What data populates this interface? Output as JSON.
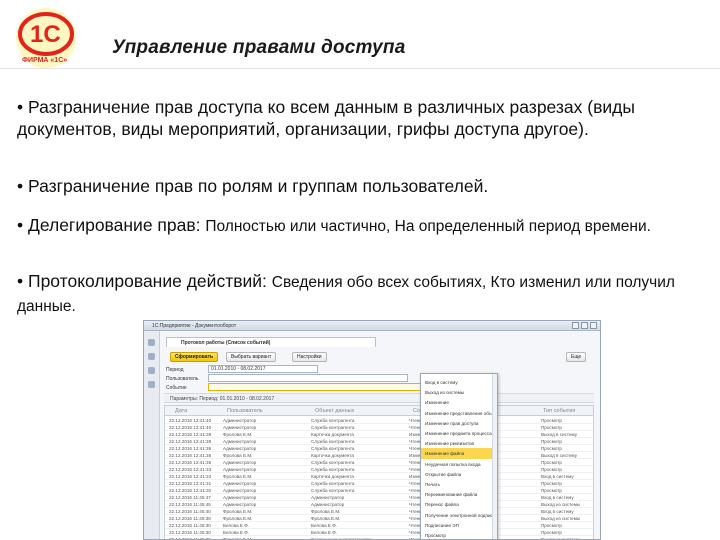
{
  "header": {
    "logo_text": "1С",
    "logo_caption": "ФИРМА «1С»",
    "title": "Управление правами доступа"
  },
  "bullets": [
    {
      "main": "• Разграничение прав доступа ко всем данным в различных разрезах (виды документов, виды мероприятий, организации, грифы доступа другое).",
      "sub": ""
    },
    {
      "main": "• Разграничение прав по ролям и группам пользователей.",
      "sub": ""
    },
    {
      "main": "• Делегирование прав: ",
      "sub": "Полностью или частично, На определенный период времени."
    },
    {
      "main": "• Протоколирование действий: ",
      "sub": "Сведения обо всех событиях, Кто изменил или получил данные."
    }
  ],
  "app": {
    "window_title": "1С:Предприятие - Документооборот",
    "tab_title": "Протокол работы (Список событий)",
    "toolbar": {
      "form_button": "Сформировать",
      "print_button": "Выбрать вариант",
      "settings_button": "Настройки",
      "more_button": "Еще"
    },
    "filters": [
      {
        "label": "Период",
        "value": "01.01.2010 - 08.02.2017"
      },
      {
        "label": "Пользователь",
        "value": ""
      },
      {
        "label": "Событие",
        "value": ""
      }
    ],
    "params_text": "Параметры:   Период: 01.01.2010 - 08.02.2017",
    "grid_headers": {
      "date": "Дата",
      "user": "Пользователь",
      "object": "Объект данных",
      "event": "Событие",
      "event_type": "Тип события"
    },
    "rows": [
      {
        "date": "22.12.2016 12:41:40",
        "user": "Администратор",
        "object": "Служба контрагента",
        "event": "Чтение",
        "type": "Просмотр"
      },
      {
        "date": "22.12.2016 12:41:40",
        "user": "Администратор",
        "object": "Служба контрагента",
        "event": "Чтение",
        "type": "Просмотр"
      },
      {
        "date": "22.12.2016 12:41:38",
        "user": "Фролова Е.М.",
        "object": "Карточка документа",
        "event": "Изменение",
        "type": "Выход в систему"
      },
      {
        "date": "22.12.2016 12:41:38",
        "user": "Администратор",
        "object": "Служба контрагента",
        "event": "Чтение",
        "type": "Просмотр"
      },
      {
        "date": "22.12.2016 12:41:36",
        "user": "Администратор",
        "object": "Служба контрагента",
        "event": "Чтение",
        "type": "Просмотр"
      },
      {
        "date": "22.12.2016 12:41:35",
        "user": "Фролова Е.М.",
        "object": "Карточка документа",
        "event": "Изменение",
        "type": "Выход в систему"
      },
      {
        "date": "22.12.2016 12:41:35",
        "user": "Администратор",
        "object": "Служба контрагента",
        "event": "Чтение",
        "type": "Просмотр"
      },
      {
        "date": "22.12.2016 12:41:33",
        "user": "Администратор",
        "object": "Служба контрагента",
        "event": "Чтение",
        "type": "Просмотр"
      },
      {
        "date": "22.12.2016 12:41:33",
        "user": "Фролова Е.М.",
        "object": "Карточка документа",
        "event": "Изменение",
        "type": "Вход в систему"
      },
      {
        "date": "22.12.2016 12:41:31",
        "user": "Администратор",
        "object": "Служба контрагента",
        "event": "Чтение",
        "type": "Просмотр"
      },
      {
        "date": "22.12.2016 12:41:30",
        "user": "Администратор",
        "object": "Служба контрагента",
        "event": "Чтение",
        "type": "Просмотр"
      },
      {
        "date": "22.12.2016 11:45:47",
        "user": "Администратор",
        "object": "Администратор",
        "event": "Чтение",
        "type": "Вход в систему"
      },
      {
        "date": "22.12.2016 11:45:45",
        "user": "Администратор",
        "object": "Администратор",
        "event": "Чтение",
        "type": "Выход из системы"
      },
      {
        "date": "22.12.2016 11:45:40",
        "user": "Фролова Е.М.",
        "object": "Фролова Е.М.",
        "event": "Чтение",
        "type": "Вход в систему"
      },
      {
        "date": "22.12.2016 11:45:38",
        "user": "Фролова Е.М.",
        "object": "Фролова Е.М.",
        "event": "Чтение",
        "type": "Выход из системы"
      },
      {
        "date": "22.12.2016 11:45:30",
        "user": "Белова Е.Ф.",
        "object": "Белова Е.Ф.",
        "event": "Чтение",
        "type": "Просмотр"
      },
      {
        "date": "22.12.2016 11:45:30",
        "user": "Белова Е.Ф.",
        "object": "Белова Е.Ф.",
        "event": "Чтение",
        "type": "Просмотр"
      },
      {
        "date": "22.12.2016 11:45:29",
        "user": "Фролова Е.М.",
        "object": "Соглашение с контрагентом",
        "event": "Изменение",
        "type": "Выход из системы"
      }
    ],
    "dropdown_items": [
      "Вход в систему",
      "Выход из системы",
      "Изменение",
      "Изменение представления объекта",
      "Изменение прав доступа",
      "Изменение предмета процесса",
      "Изменение реквизитов",
      "Изменение файла",
      "Неудачная попытка входа",
      "Открытие файла",
      "Печать",
      "Переименование файла",
      "Перенос файла",
      "Получение электронной подписи",
      "Подписание ЭП",
      "Просмотр"
    ],
    "dropdown_selected_index": 7
  }
}
